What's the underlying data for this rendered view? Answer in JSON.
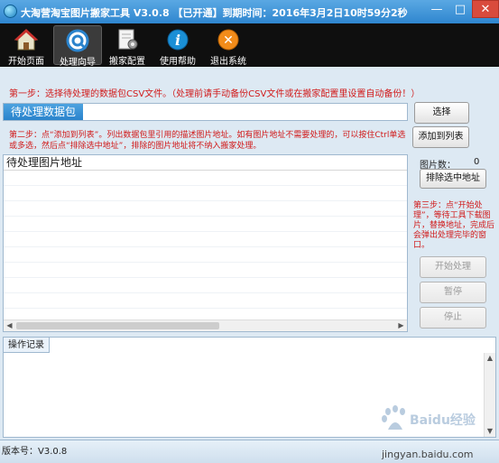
{
  "window": {
    "title": "大淘营淘宝图片搬家工具 V3.0.8 【已开通】到期时间：2016年3月2日10时59分2秒",
    "min": "—",
    "max": "□",
    "close": "✕"
  },
  "toolbar": {
    "items": [
      {
        "label": "开始页面",
        "icon": "home-icon"
      },
      {
        "label": "处理向导",
        "icon": "wizard-icon"
      },
      {
        "label": "搬家配置",
        "icon": "config-icon"
      },
      {
        "label": "使用帮助",
        "icon": "help-icon"
      },
      {
        "label": "退出系统",
        "icon": "exit-icon"
      }
    ],
    "help_glyph": "i",
    "exit_glyph": "✕"
  },
  "step1": "第一步：选择待处理的数据包CSV文件。（处理前请手动备份CSV文件或在搬家配置里设置自动备份！）",
  "package": {
    "tab_label": "待处理数据包",
    "select_button": "选择",
    "add_button": "添加到列表"
  },
  "step2": "第二步：点“添加到列表”。列出数据包里引用的描述图片地址。如有图片地址不需要处理的，可以按住Ctrl单选或多选，然后点“排除选中地址”，排除的图片地址将不纳入搬家处理。",
  "list": {
    "header": "待处理图片地址",
    "scroll_left": "◀",
    "scroll_right": "▶"
  },
  "right_panel": {
    "count_label": "图片数：",
    "count_value": "0",
    "exclude_button": "排除选中地址",
    "step3": "第三步：点“开始处理”，等待工具下载图片，替换地址，完成后会弹出处理完毕的窗口。",
    "start_button": "开始处理",
    "pause_button": "暂停",
    "stop_button": "停止"
  },
  "log": {
    "tab_label": "操作记录",
    "scroll_up": "▲",
    "scroll_down": "▼"
  },
  "status": {
    "version": "版本号：V3.0.8",
    "watermark_site": "jingyan.baidu.com",
    "watermark_brand": "Baidu经验"
  },
  "colors": {
    "titlebar": "#2f86cf",
    "toolbar": "#0f0f0f",
    "instruction_red": "#d11a1a",
    "tab_blue": "#2a83cc",
    "panel_bg": "#dde9f3"
  }
}
